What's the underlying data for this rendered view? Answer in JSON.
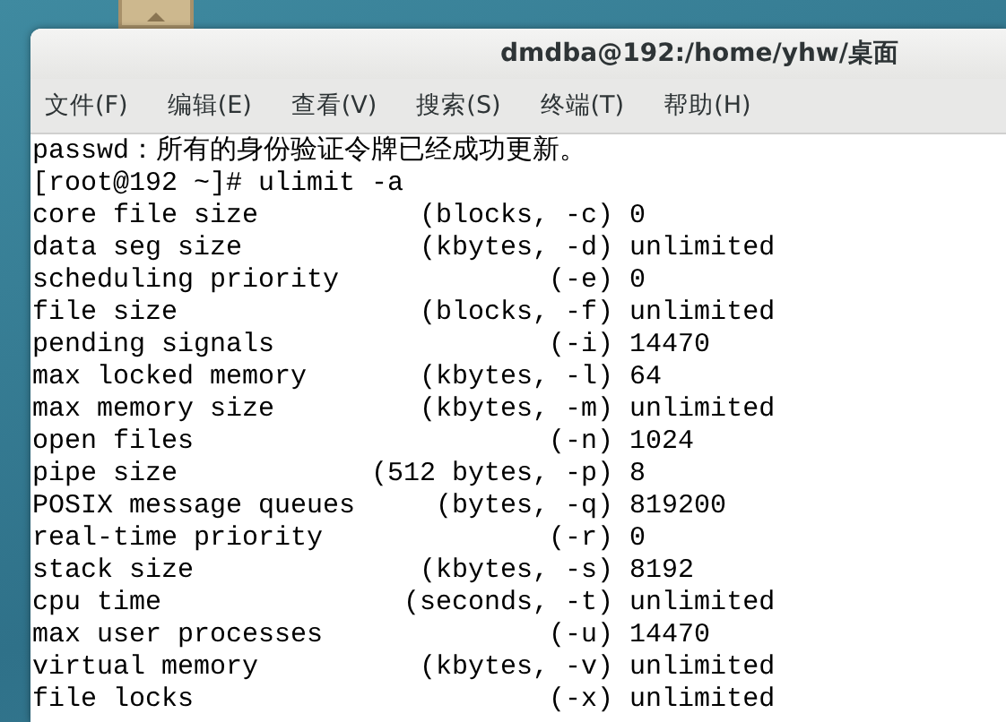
{
  "window": {
    "title": "dmdba@192:/home/yhw/桌面"
  },
  "menu": [
    "文件(F)",
    "编辑(E)",
    "查看(V)",
    "搜索(S)",
    "终端(T)",
    "帮助(H)"
  ],
  "terminal": {
    "lines": [
      "passwd：所有的身份验证令牌已经成功更新。",
      "[root@192 ~]# ulimit -a",
      "core file size          (blocks, -c) 0",
      "data seg size           (kbytes, -d) unlimited",
      "scheduling priority             (-e) 0",
      "file size               (blocks, -f) unlimited",
      "pending signals                 (-i) 14470",
      "max locked memory       (kbytes, -l) 64",
      "max memory size         (kbytes, -m) unlimited",
      "open files                      (-n) 1024",
      "pipe size            (512 bytes, -p) 8",
      "POSIX message queues     (bytes, -q) 819200",
      "real-time priority              (-r) 0",
      "stack size              (kbytes, -s) 8192",
      "cpu time               (seconds, -t) unlimited",
      "max user processes              (-u) 14470",
      "virtual memory          (kbytes, -v) unlimited",
      "file locks                      (-x) unlimited"
    ]
  }
}
